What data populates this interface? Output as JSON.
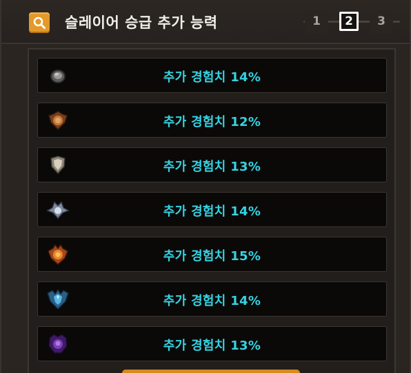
{
  "header": {
    "title": "슬레이어 승급 추가 능력",
    "search_icon": "search-icon",
    "accent": "#e39a2a"
  },
  "pager": {
    "pages": [
      "1",
      "2",
      "3"
    ],
    "active_index": 1
  },
  "rows": [
    {
      "rank": "iron",
      "emblem_icon": "iron-rank-emblem-icon",
      "text": "추가 경험치 14%",
      "color": "#8d8d8d"
    },
    {
      "rank": "bronze",
      "emblem_icon": "bronze-rank-emblem-icon",
      "text": "추가 경험치 12%",
      "color": "#b8733a"
    },
    {
      "rank": "silver",
      "emblem_icon": "silver-rank-emblem-icon",
      "text": "추가 경험치 13%",
      "color": "#c9c2b7"
    },
    {
      "rank": "platinum",
      "emblem_icon": "platinum-rank-emblem-icon",
      "text": "추가 경험치 14%",
      "color": "#b8c4d4"
    },
    {
      "rank": "gold",
      "emblem_icon": "gold-rank-emblem-icon",
      "text": "추가 경험치 15%",
      "color": "#e08a2e"
    },
    {
      "rank": "diamond",
      "emblem_icon": "diamond-rank-emblem-icon",
      "text": "추가 경험치 14%",
      "color": "#4aa6d8"
    },
    {
      "rank": "master",
      "emblem_icon": "master-rank-emblem-icon",
      "text": "추가 경험치 13%",
      "color": "#7a3fb8"
    }
  ],
  "text_color": "#35d3e2"
}
